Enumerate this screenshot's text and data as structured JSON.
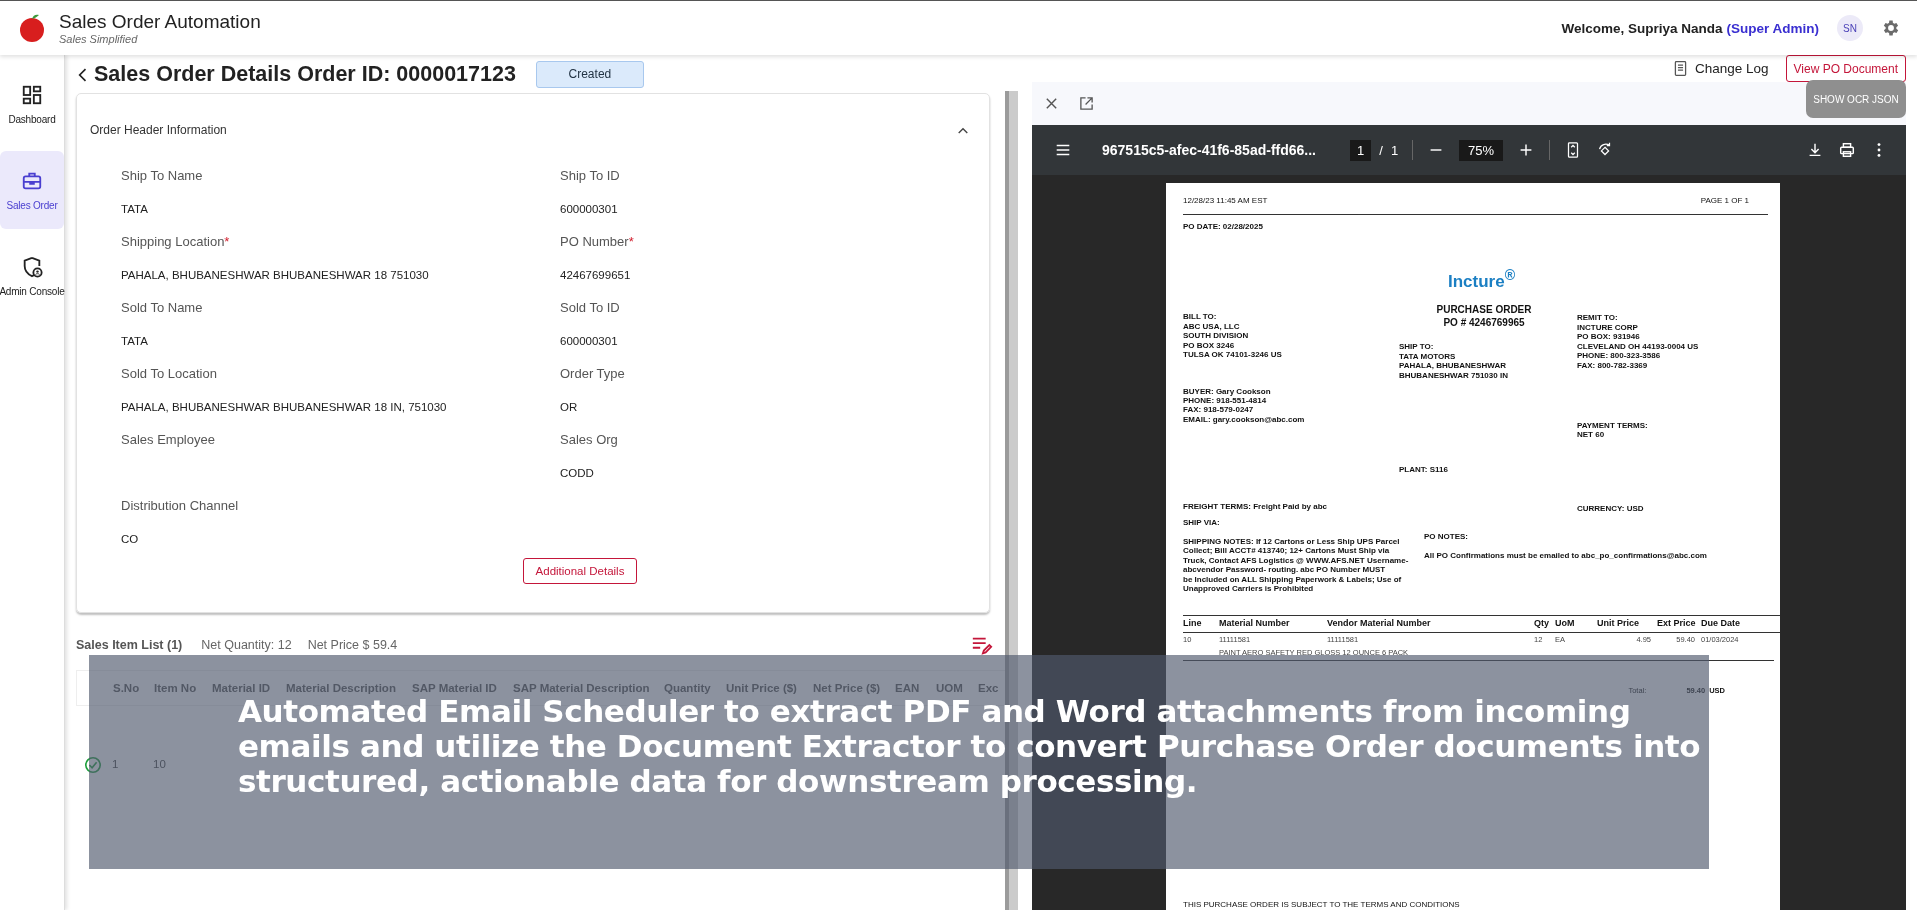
{
  "app": {
    "title": "Sales Order Automation",
    "subtitle": "Sales Simplified"
  },
  "user": {
    "welcome": "Welcome, Supriya Nanda",
    "role": "(Super Admin)",
    "initials": "SN"
  },
  "sidebar": {
    "items": [
      {
        "label": "Dashboard",
        "selected": false
      },
      {
        "label": "Sales Order",
        "selected": true
      },
      {
        "label": "Admin Console",
        "selected": false
      }
    ]
  },
  "page": {
    "title": "Sales Order Details Order ID: 0000017123",
    "status": "Created",
    "change_log": "Change Log",
    "view_po": "View PO Document"
  },
  "order_header": {
    "title": "Order Header Information",
    "expanded": true,
    "required_mark": "*",
    "button": "Additional Details",
    "fields": [
      {
        "label": "Ship To Name",
        "value": "TATA",
        "required": false
      },
      {
        "label": "Ship To ID",
        "value": "600000301",
        "required": false
      },
      {
        "label": "Shipping Location",
        "value": "PAHALA, BHUBANESHWAR BHUBANESHWAR 18 751030",
        "required": true
      },
      {
        "label": "PO Number",
        "value": "42467699651",
        "required": true
      },
      {
        "label": "Sold To Name",
        "value": "TATA",
        "required": false
      },
      {
        "label": "Sold To ID",
        "value": "600000301",
        "required": false
      },
      {
        "label": "Sold To Location",
        "value": "PAHALA, BHUBANESHWAR BHUBANESHWAR 18 IN, 751030",
        "required": false
      },
      {
        "label": "Order Type",
        "value": "OR",
        "required": false
      },
      {
        "label": "Sales Employee",
        "required": false
      },
      {
        "label": "Sales Org",
        "value": "CODD",
        "required": false
      },
      {
        "label": "Distribution Channel",
        "value": "CO",
        "required": false
      }
    ]
  },
  "sales_items": {
    "title": "Sales Item List (1)",
    "net_quantity": "Net Quantity: 12",
    "net_price": "Net Price $ 59.4",
    "columns": [
      "S.No",
      "Item No",
      "Material ID",
      "Material Description",
      "SAP Material ID",
      "SAP Material Description",
      "Quantity",
      "Unit Price ($)",
      "Net Price ($)",
      "EAN",
      "UOM",
      "Exc"
    ],
    "rows": [
      {
        "valid": true,
        "sno": "1",
        "item_no": "10"
      }
    ]
  },
  "viewer": {
    "show_ocr": "SHOW OCR JSON",
    "file_name": "967515c5-afec-41f6-85ad-ffd66...",
    "page": "1",
    "page_separator": "/",
    "page_count": "1",
    "zoom": "75%"
  },
  "document": {
    "timestamp": "12/28/23 11:45 AM EST",
    "page_label": "PAGE 1 OF 1",
    "po_date": "PO DATE: 02/28/2025",
    "logo": "Incture$^{®}$",
    "title": "PURCHASE ORDER",
    "po_number": "PO # 4246769965",
    "bill_to": [
      "BILL TO:",
      "ABC USA, LLC",
      "SOUTH DIVISION",
      "PO BOX 3246",
      "TULSA OK 74101-3246 US"
    ],
    "ship_to": [
      "SHIP TO:",
      "TATA MOTORS",
      "PAHALA, BHUBANESHWAR",
      "BHUBANESHWAR 751030 IN"
    ],
    "remit_to": [
      "REMIT TO:",
      "INCTURE CORP",
      "PO BOX: 931946",
      "CLEVELAND OH 44193-0004 US",
      "PHONE: 800-323-3586",
      "FAX: 800-782-3369"
    ],
    "buyer": [
      "BUYER: Gary Cookson",
      "PHONE: 918-551-4814",
      "FAX: 918-579-0247",
      "EMAIL: gary.cookson@abc.com"
    ],
    "payment_terms": [
      "PAYMENT TERMS:",
      "NET 60"
    ],
    "plant": "PLANT: S116",
    "freight_terms": "FREIGHT TERMS: Freight Paid by abc",
    "currency": "CURRENCY: USD",
    "ship_via": "SHIP VIA:",
    "shipping_notes": [
      "SHIPPING NOTES: If 12 Cartons or Less Ship UPS Parcel",
      "Collect; Bill ACCT# 413740; 12+ Cartons Must Ship via",
      "Truck, Contact AFS Logistics @ WWW.AFS.NET Username-",
      "abcvendor Password- routing. abc PO Number MUST",
      "be Included on ALL Shipping Paperwork & Labels; Use of",
      "Unapproved Carriers is Prohibited"
    ],
    "po_notes_title": "PO NOTES:",
    "po_notes": "All PO Confirmations must be emailed to abc_po_confirmations@abc.com",
    "columns": [
      "Line",
      "Material Number",
      "Vendor Material Number",
      "Qty",
      "UoM",
      "Unit Price",
      "Ext Price",
      "Due Date"
    ],
    "lines": [
      {
        "line": "10",
        "material": "11111581",
        "vendor_material": "11111581",
        "qty": "12",
        "uom": "EA",
        "unit_price": "4.95",
        "ext_price": "59.40",
        "due_date": "01/03/2024",
        "description": "PAINT AERO SAFETY RED GLOSS 12 OUNCE 6 PACK"
      }
    ],
    "total_label": "Total:",
    "total": "59.40",
    "total_currency": "USD",
    "terms": "THIS PURCHASE ORDER IS SUBJECT TO THE TERMS AND CONDITIONS"
  },
  "banner": {
    "lines": [
      "Automated Email Scheduler to extract PDF and Word attachments from incoming",
      "emails and utilize the Document Extractor to convert Purchase Order documents into",
      "structured, actionable data for downstream processing."
    ]
  }
}
